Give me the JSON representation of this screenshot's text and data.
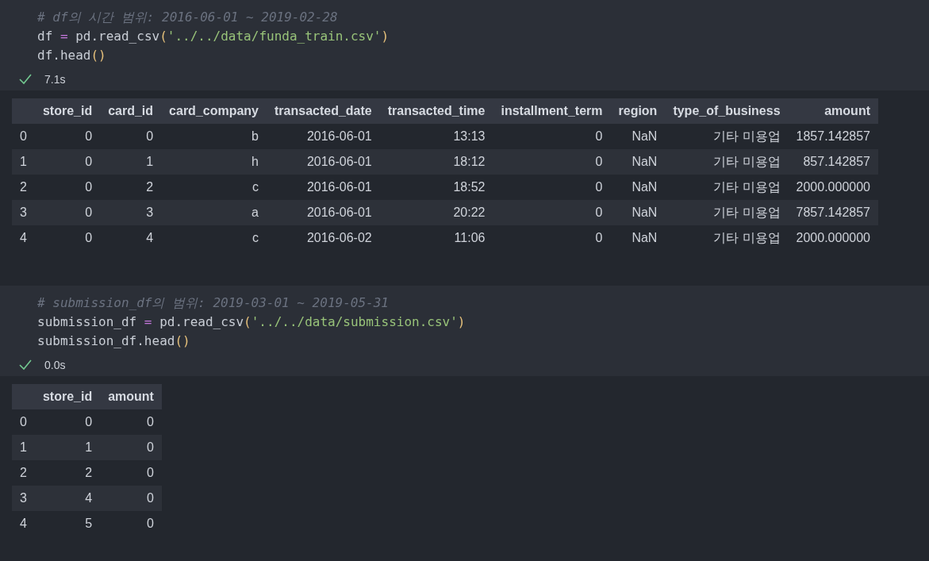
{
  "cells": [
    {
      "code": [
        [
          {
            "kind": "comment",
            "text": "# df의 시간 범위: 2016-06-01 ~ 2019-02-28"
          }
        ],
        [
          {
            "kind": "name",
            "text": "df "
          },
          {
            "kind": "op",
            "text": "="
          },
          {
            "kind": "name",
            "text": " pd.read_csv"
          },
          {
            "kind": "paren",
            "text": "("
          },
          {
            "kind": "string",
            "text": "'../../data/funda_train.csv'"
          },
          {
            "kind": "paren",
            "text": ")"
          }
        ],
        [
          {
            "kind": "name",
            "text": "df.head"
          },
          {
            "kind": "paren",
            "text": "()"
          }
        ]
      ],
      "status": {
        "ok": true,
        "time": "7.1s"
      },
      "output": {
        "columns": [
          "",
          "store_id",
          "card_id",
          "card_company",
          "transacted_date",
          "transacted_time",
          "installment_term",
          "region",
          "type_of_business",
          "amount"
        ],
        "rows": [
          [
            "0",
            "0",
            "0",
            "b",
            "2016-06-01",
            "13:13",
            "0",
            "NaN",
            "기타 미용업",
            "1857.142857"
          ],
          [
            "1",
            "0",
            "1",
            "h",
            "2016-06-01",
            "18:12",
            "0",
            "NaN",
            "기타 미용업",
            "857.142857"
          ],
          [
            "2",
            "0",
            "2",
            "c",
            "2016-06-01",
            "18:52",
            "0",
            "NaN",
            "기타 미용업",
            "2000.000000"
          ],
          [
            "3",
            "0",
            "3",
            "a",
            "2016-06-01",
            "20:22",
            "0",
            "NaN",
            "기타 미용업",
            "7857.142857"
          ],
          [
            "4",
            "0",
            "4",
            "c",
            "2016-06-02",
            "11:06",
            "0",
            "NaN",
            "기타 미용업",
            "2000.000000"
          ]
        ]
      }
    },
    {
      "code": [
        [
          {
            "kind": "comment",
            "text": "# submission_df의 범위: 2019-03-01 ~ 2019-05-31"
          }
        ],
        [
          {
            "kind": "name",
            "text": "submission_df "
          },
          {
            "kind": "op",
            "text": "="
          },
          {
            "kind": "name",
            "text": " pd.read_csv"
          },
          {
            "kind": "paren",
            "text": "("
          },
          {
            "kind": "string",
            "text": "'../../data/submission.csv'"
          },
          {
            "kind": "paren",
            "text": ")"
          }
        ],
        [
          {
            "kind": "name",
            "text": "submission_df.head"
          },
          {
            "kind": "paren",
            "text": "()"
          }
        ]
      ],
      "status": {
        "ok": true,
        "time": "0.0s"
      },
      "output": {
        "columns": [
          "",
          "store_id",
          "amount"
        ],
        "rows": [
          [
            "0",
            "0",
            "0"
          ],
          [
            "1",
            "1",
            "0"
          ],
          [
            "2",
            "2",
            "0"
          ],
          [
            "3",
            "4",
            "0"
          ],
          [
            "4",
            "5",
            "0"
          ]
        ]
      }
    }
  ]
}
